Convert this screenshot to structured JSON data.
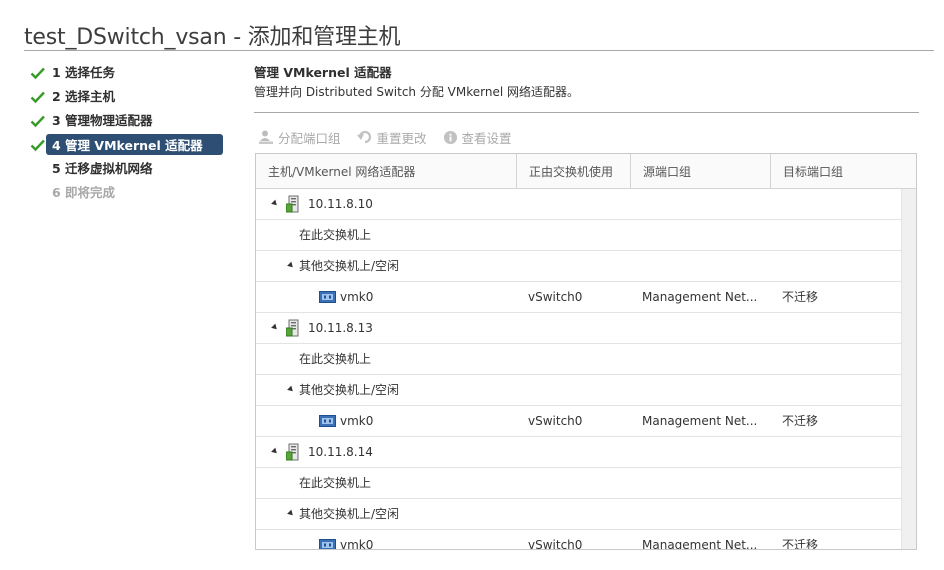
{
  "page": {
    "title": "test_DSwitch_vsan - 添加和管理主机"
  },
  "steps": [
    {
      "label": "1 选择任务",
      "state": "done"
    },
    {
      "label": "2 选择主机",
      "state": "done"
    },
    {
      "label": "3 管理物理适配器",
      "state": "done"
    },
    {
      "label": "4 管理 VMkernel 适配器",
      "state": "active"
    },
    {
      "label": "5 迁移虚拟机网络",
      "state": "pending"
    },
    {
      "label": "6 即将完成",
      "state": "disabled"
    }
  ],
  "section": {
    "title": "管理 VMkernel 适配器",
    "description": "管理并向 Distributed Switch 分配 VMkernel 网络适配器。"
  },
  "toolbar": {
    "assign_label": "分配端口组",
    "reset_label": "重置更改",
    "view_label": "查看设置"
  },
  "grid": {
    "columns": [
      "主机/VMkernel 网络适配器",
      "正由交换机使用",
      "源端口组",
      "目标端口组"
    ],
    "hosts": [
      {
        "name": "10.11.8.10",
        "on_switch": "在此交换机上",
        "other_switch": "其他交换机上/空闲",
        "adapter": {
          "name": "vmk0",
          "in_use_by": "vSwitch0",
          "source": "Management Net...",
          "target": "不迁移"
        }
      },
      {
        "name": "10.11.8.13",
        "on_switch": "在此交换机上",
        "other_switch": "其他交换机上/空闲",
        "adapter": {
          "name": "vmk0",
          "in_use_by": "vSwitch0",
          "source": "Management Net...",
          "target": "不迁移"
        }
      },
      {
        "name": "10.11.8.14",
        "on_switch": "在此交换机上",
        "other_switch": "其他交换机上/空闲",
        "adapter": {
          "name": "vmk0",
          "in_use_by": "vSwitch0",
          "source": "Management Net...",
          "target": "不迁移"
        }
      }
    ]
  },
  "colors": {
    "active_step_bg": "#2e4f73",
    "check_green": "#3a9a2c",
    "disabled_text": "#a8a8a8"
  }
}
